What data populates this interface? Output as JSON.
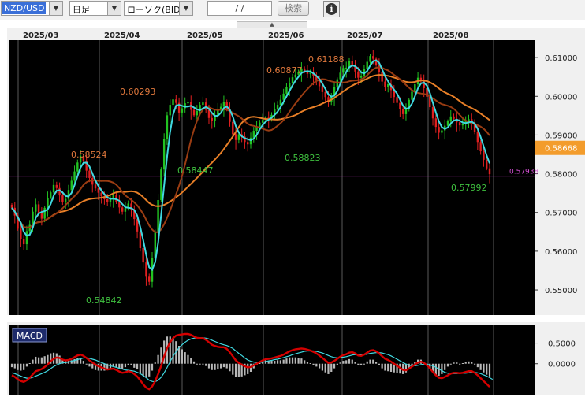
{
  "toolbar": {
    "pair": "NZD/USD",
    "timeframe": "日足",
    "chart_type": "ローソク(BID)",
    "date_value": "/ /",
    "search_label": "検索",
    "info_label": "i"
  },
  "dropdown_arrow": "▼",
  "scroll_handle": "▲",
  "chart_data": [
    {
      "type": "candlestick",
      "title": "",
      "x_labels": [
        "2025/03",
        "2025/04",
        "2025/05",
        "2025/06",
        "2025/07",
        "2025/08"
      ],
      "y_ticks": [
        "0.61000",
        "0.60000",
        "0.59000",
        "0.58000",
        "0.57000",
        "0.56000",
        "0.55000"
      ],
      "ylim": [
        0.5435,
        0.6145
      ],
      "current_price": "0.58668",
      "line_price": "0.57938",
      "annotations": [
        {
          "text": "0.58524",
          "value": 0.58524,
          "kind": "high"
        },
        {
          "text": "0.60293",
          "value": 0.60293,
          "kind": "high"
        },
        {
          "text": "0.60877",
          "value": 0.60877,
          "kind": "high"
        },
        {
          "text": "0.61188",
          "value": 0.61188,
          "kind": "high"
        },
        {
          "text": "0.54842",
          "value": 0.54842,
          "kind": "low"
        },
        {
          "text": "0.58447",
          "value": 0.58447,
          "kind": "low"
        },
        {
          "text": "0.58823",
          "value": 0.58823,
          "kind": "low"
        },
        {
          "text": "0.57992",
          "value": 0.57992,
          "kind": "low"
        }
      ],
      "closes": [
        0.5712,
        0.5692,
        0.5658,
        0.5632,
        0.5618,
        0.5652,
        0.5668,
        0.5702,
        0.5721,
        0.5698,
        0.5684,
        0.5712,
        0.5738,
        0.5752,
        0.5771,
        0.5763,
        0.5744,
        0.5728,
        0.5735,
        0.5758,
        0.5782,
        0.5806,
        0.5829,
        0.5846,
        0.5832,
        0.5808,
        0.5789,
        0.5772,
        0.5762,
        0.5751,
        0.5742,
        0.5734,
        0.5728,
        0.5736,
        0.5744,
        0.5728,
        0.5713,
        0.5702,
        0.5711,
        0.5723,
        0.5708,
        0.5683,
        0.5651,
        0.5608,
        0.5571,
        0.5534,
        0.5521,
        0.5582,
        0.5651,
        0.5732,
        0.5811,
        0.5889,
        0.5951,
        0.5978,
        0.5992,
        0.5983,
        0.5958,
        0.5969,
        0.5982,
        0.5986,
        0.5965,
        0.5951,
        0.5962,
        0.5978,
        0.5984,
        0.5965,
        0.5944,
        0.5936,
        0.5952,
        0.5968,
        0.5973,
        0.5986,
        0.5968,
        0.5934,
        0.5902,
        0.5887,
        0.5902,
        0.5896,
        0.5882,
        0.5876,
        0.5893,
        0.5911,
        0.5922,
        0.5932,
        0.5939,
        0.5945,
        0.5943,
        0.5952,
        0.5968,
        0.5978,
        0.5991,
        0.6007,
        0.6023,
        0.6034,
        0.6049,
        0.6056,
        0.6063,
        0.6072,
        0.6066,
        0.6058,
        0.6061,
        0.6052,
        0.6041,
        0.6026,
        0.6011,
        0.5998,
        0.5986,
        0.6001,
        0.6023,
        0.6044,
        0.6061,
        0.6073,
        0.6074,
        0.6091,
        0.6082,
        0.6064,
        0.6048,
        0.6053,
        0.6071,
        0.6089,
        0.6104,
        0.6097,
        0.6082,
        0.6063,
        0.6038,
        0.6024,
        0.6031,
        0.6016,
        0.5998,
        0.5983,
        0.5968,
        0.5954,
        0.5966,
        0.5991,
        0.6012,
        0.6031,
        0.6048,
        0.6042,
        0.6021,
        0.5999,
        0.5972,
        0.5943,
        0.5921,
        0.5906,
        0.5912,
        0.5924,
        0.5936,
        0.5948,
        0.5942,
        0.5933,
        0.5925,
        0.5929,
        0.5936,
        0.5941,
        0.5932,
        0.5908,
        0.5882,
        0.5858,
        0.5836,
        0.5814,
        0.5799
      ]
    },
    {
      "type": "line",
      "title": "MACD",
      "y_ticks": [
        "0.5000",
        "0.0000"
      ],
      "series": [
        {
          "color": "#d40000",
          "values": [
            -0.28,
            -0.32,
            -0.38,
            -0.42,
            -0.44,
            -0.4,
            -0.34,
            -0.26,
            -0.18,
            -0.16,
            -0.13,
            -0.08,
            -0.02,
            0.06,
            0.12,
            0.15,
            0.14,
            0.1,
            0.08,
            0.09,
            0.12,
            0.16,
            0.2,
            0.22,
            0.19,
            0.14,
            0.08,
            0.03,
            -0.02,
            -0.06,
            -0.09,
            -0.12,
            -0.14,
            -0.13,
            -0.12,
            -0.15,
            -0.19,
            -0.22,
            -0.21,
            -0.18,
            -0.2,
            -0.25,
            -0.31,
            -0.4,
            -0.5,
            -0.58,
            -0.62,
            -0.55,
            -0.42,
            -0.25,
            -0.05,
            0.18,
            0.38,
            0.52,
            0.62,
            0.68,
            0.7,
            0.71,
            0.72,
            0.72,
            0.7,
            0.66,
            0.63,
            0.62,
            0.62,
            0.58,
            0.52,
            0.46,
            0.43,
            0.41,
            0.4,
            0.4,
            0.36,
            0.28,
            0.18,
            0.08,
            0.02,
            -0.02,
            -0.06,
            -0.09,
            -0.08,
            -0.04,
            0.0,
            0.04,
            0.08,
            0.11,
            0.12,
            0.13,
            0.15,
            0.17,
            0.19,
            0.22,
            0.26,
            0.3,
            0.33,
            0.35,
            0.36,
            0.37,
            0.36,
            0.34,
            0.32,
            0.29,
            0.25,
            0.2,
            0.14,
            0.08,
            0.02,
            0.03,
            0.07,
            0.12,
            0.17,
            0.21,
            0.23,
            0.27,
            0.28,
            0.25,
            0.2,
            0.19,
            0.22,
            0.27,
            0.32,
            0.33,
            0.3,
            0.25,
            0.18,
            0.12,
            0.09,
            0.05,
            0.0,
            -0.05,
            -0.1,
            -0.15,
            -0.16,
            -0.12,
            -0.07,
            -0.02,
            0.03,
            0.05,
            0.02,
            -0.04,
            -0.11,
            -0.2,
            -0.28,
            -0.34,
            -0.35,
            -0.32,
            -0.28,
            -0.24,
            -0.22,
            -0.22,
            -0.23,
            -0.22,
            -0.2,
            -0.18,
            -0.18,
            -0.22,
            -0.28,
            -0.35,
            -0.42,
            -0.49,
            -0.56
          ]
        },
        {
          "color": "#40d8e0",
          "values": [
            -0.22,
            -0.24,
            -0.27,
            -0.3,
            -0.33,
            -0.35,
            -0.35,
            -0.33,
            -0.3,
            -0.27,
            -0.24,
            -0.21,
            -0.17,
            -0.12,
            -0.07,
            -0.03,
            0.0,
            0.02,
            0.03,
            0.04,
            0.06,
            0.08,
            0.1,
            0.12,
            0.14,
            0.14,
            0.13,
            0.11,
            0.09,
            0.06,
            0.03,
            0.0,
            -0.03,
            -0.05,
            -0.07,
            -0.09,
            -0.11,
            -0.13,
            -0.15,
            -0.16,
            -0.17,
            -0.18,
            -0.21,
            -0.24,
            -0.29,
            -0.34,
            -0.4,
            -0.43,
            -0.44,
            -0.4,
            -0.33,
            -0.22,
            -0.09,
            0.05,
            0.18,
            0.29,
            0.39,
            0.46,
            0.52,
            0.57,
            0.6,
            0.62,
            0.63,
            0.63,
            0.63,
            0.62,
            0.6,
            0.57,
            0.54,
            0.51,
            0.48,
            0.46,
            0.44,
            0.41,
            0.37,
            0.31,
            0.25,
            0.2,
            0.14,
            0.09,
            0.06,
            0.04,
            0.03,
            0.03,
            0.04,
            0.05,
            0.07,
            0.08,
            0.1,
            0.11,
            0.13,
            0.15,
            0.17,
            0.19,
            0.22,
            0.24,
            0.26,
            0.28,
            0.3,
            0.31,
            0.31,
            0.31,
            0.3,
            0.28,
            0.26,
            0.23,
            0.2,
            0.17,
            0.15,
            0.14,
            0.15,
            0.16,
            0.17,
            0.19,
            0.21,
            0.22,
            0.22,
            0.22,
            0.22,
            0.23,
            0.25,
            0.26,
            0.27,
            0.27,
            0.26,
            0.24,
            0.22,
            0.19,
            0.15,
            0.11,
            0.07,
            0.03,
            -0.01,
            -0.04,
            -0.05,
            -0.05,
            -0.04,
            -0.02,
            -0.01,
            -0.01,
            -0.03,
            -0.05,
            -0.09,
            -0.13,
            -0.17,
            -0.21,
            -0.23,
            -0.24,
            -0.24,
            -0.24,
            -0.23,
            -0.23,
            -0.23,
            -0.22,
            -0.21,
            -0.21,
            -0.22,
            -0.24,
            -0.27,
            -0.3,
            -0.34,
            -0.38
          ]
        }
      ]
    }
  ]
}
